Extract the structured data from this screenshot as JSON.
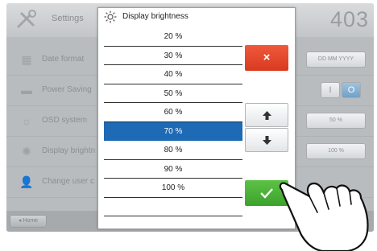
{
  "header": {
    "title": "Settings",
    "program_number": "403"
  },
  "settings_rows": [
    {
      "label": "Date format",
      "value": "DD MM YYYY",
      "icon": "calendar-icon"
    },
    {
      "label": "Power Saving",
      "toggle_off": "I",
      "toggle_on": "O",
      "icon": "power-saving-icon"
    },
    {
      "label": "OSD system",
      "value": "50 %",
      "icon": "osd-icon"
    },
    {
      "label": "Display brightn",
      "value": "100 %",
      "icon": "brightness-icon"
    },
    {
      "label": "Change user c",
      "icon": "user-icon"
    }
  ],
  "footer": {
    "home_label": "Home"
  },
  "dialog": {
    "title": "Display brightness",
    "options": [
      "20 %",
      "30 %",
      "40 %",
      "50 %",
      "60 %",
      "70 %",
      "80 %",
      "90 %",
      "100 %"
    ],
    "selected_index": 5,
    "cancel_symbol": "×"
  },
  "colors": {
    "selected": "#1e6ab4",
    "cancel": "#e4482c",
    "confirm": "#4cb43a"
  }
}
